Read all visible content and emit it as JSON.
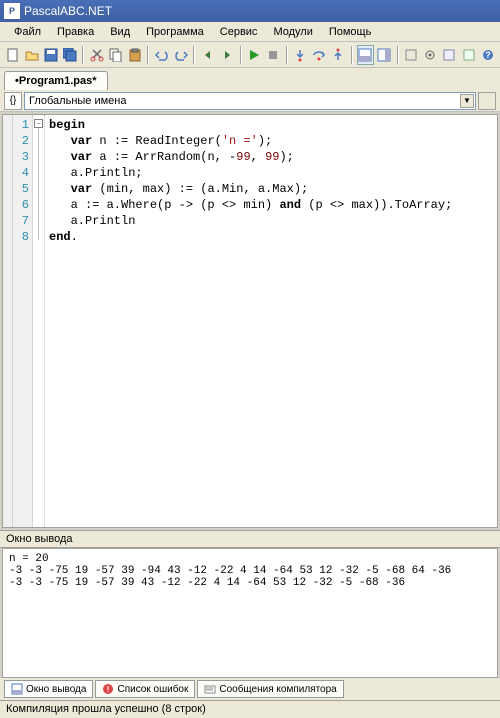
{
  "title": "PascalABC.NET",
  "menu": [
    "Файл",
    "Правка",
    "Вид",
    "Программа",
    "Сервис",
    "Модули",
    "Помощь"
  ],
  "toolbar_icons": [
    "new-file",
    "open",
    "save",
    "save-all",
    "cut",
    "copy",
    "paste",
    "undo",
    "redo",
    "back",
    "forward",
    "run",
    "pause",
    "stop",
    "step-over",
    "step-into",
    "step-out",
    "panel-1",
    "panel-2",
    "panel-3",
    "options",
    "tool-a",
    "tool-b",
    "help"
  ],
  "tab": "•Program1.pas*",
  "scope_dropdown": "Глобальные имена",
  "code_lines": [
    {
      "n": 1,
      "t": "begin"
    },
    {
      "n": 2,
      "t": "   var n := ReadInteger('n =');"
    },
    {
      "n": 3,
      "t": "   var a := ArrRandom(n, -99, 99);"
    },
    {
      "n": 4,
      "t": "   a.Println;"
    },
    {
      "n": 5,
      "t": "   var (min, max) := (a.Min, a.Max);"
    },
    {
      "n": 6,
      "t": "   a := a.Where(p -> (p <> min) and (p <> max)).ToArray;"
    },
    {
      "n": 7,
      "t": "   a.Println"
    },
    {
      "n": 8,
      "t": "end."
    }
  ],
  "output_title": "Окно вывода",
  "output_text": "n = 20\n-3 -3 -75 19 -57 39 -94 43 -12 -22 4 14 -64 53 12 -32 -5 -68 64 -36\n-3 -3 -75 19 -57 39 43 -12 -22 4 14 -64 53 12 -32 -5 -68 -36",
  "bottom_tabs": [
    {
      "label": "Окно вывода",
      "active": true
    },
    {
      "label": "Список ошибок",
      "active": false
    },
    {
      "label": "Сообщения компилятора",
      "active": false
    }
  ],
  "status": "Компиляция прошла успешно (8 строк)"
}
